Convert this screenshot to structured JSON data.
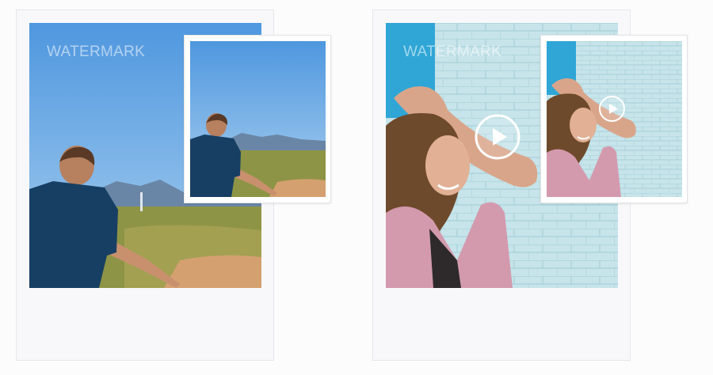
{
  "cards": [
    {
      "id": "landscape",
      "watermark_text": "WATERMARK",
      "photo_subject": "man-in-blue-shirt-walking-in-field",
      "has_play_button": false
    },
    {
      "id": "video",
      "watermark_text": "WATERMARK",
      "photo_subject": "woman-leaning-on-painted-brick-wall",
      "has_play_button": true
    }
  ],
  "colors": {
    "sky": "#5a9ee0",
    "field": "#9a9a4a",
    "shirt": "#173f63",
    "wall": "#c6e4ea",
    "wall_blue": "#2fa6d6",
    "cardigan": "#d39aae"
  }
}
